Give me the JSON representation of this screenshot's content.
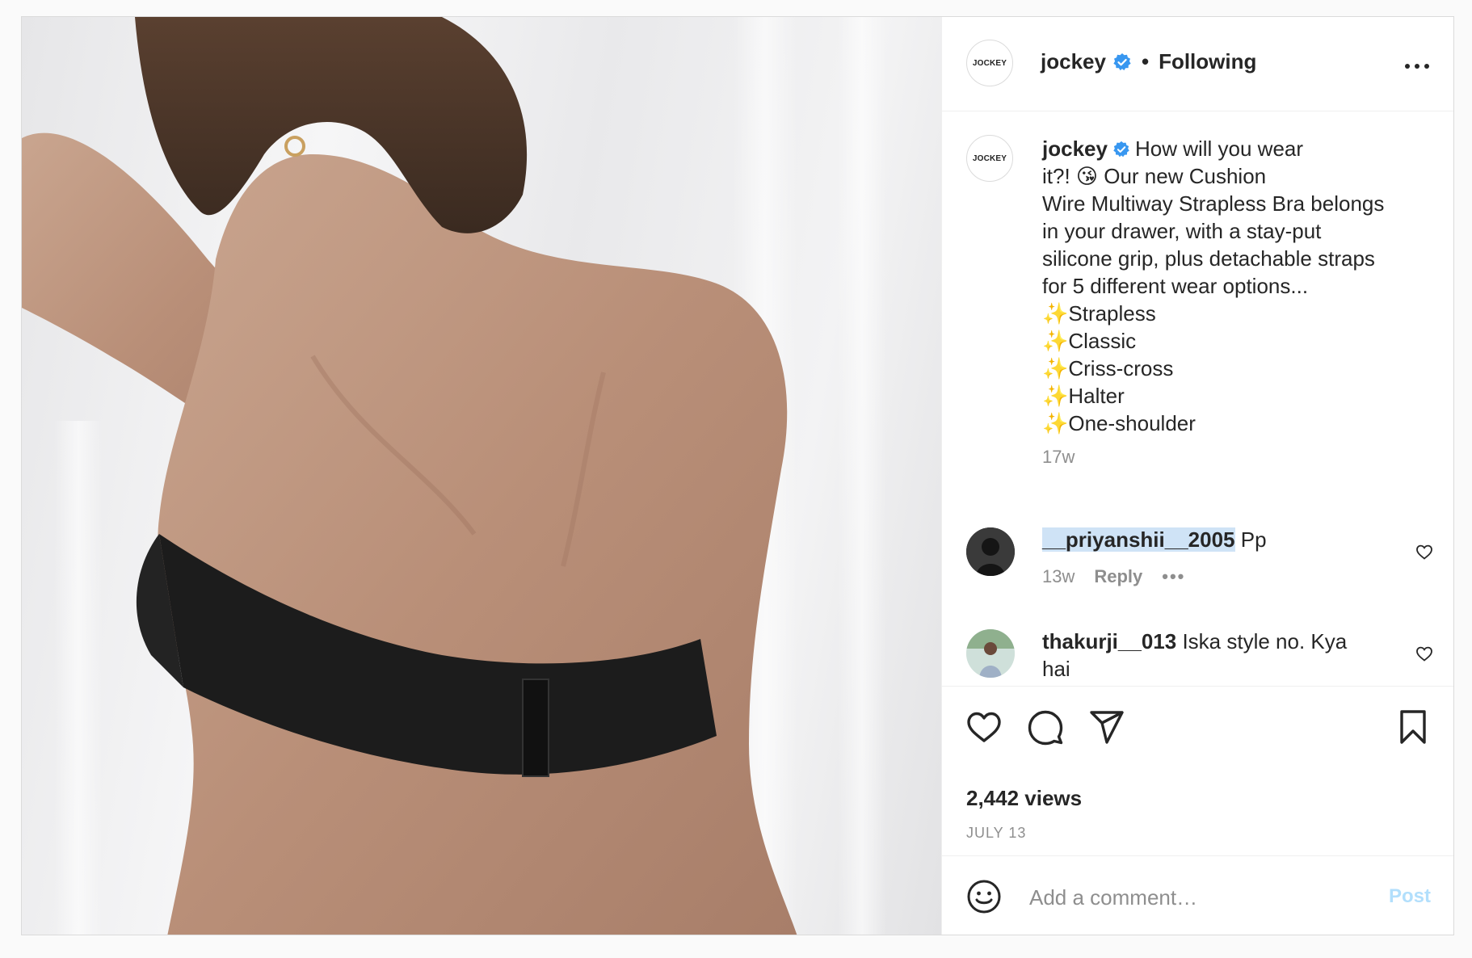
{
  "post": {
    "image_alt": "Woman wearing black strapless bra seen from the back",
    "account": {
      "avatar_text": "JOCKEY",
      "username": "jockey",
      "separator": "•",
      "follow_state": "Following"
    },
    "caption": {
      "username": "jockey",
      "lines": [
        "How will you wear",
        "it?! 😘 Our new Cushion",
        "Wire Multiway Strapless Bra belongs",
        "in your drawer, with a stay-put",
        "silicone grip, plus detachable straps",
        "for 5 different wear options...",
        "✨Strapless",
        "✨Classic",
        "✨Criss-cross",
        "✨Halter",
        "✨One-shoulder"
      ],
      "time": "17w"
    },
    "comments": [
      {
        "username": "__priyanshii__2005",
        "text": "Pp",
        "time": "13w",
        "reply_label": "Reply",
        "more_label": "•••"
      },
      {
        "username": "thakurji__013",
        "text_line1": "Iska style no. Kya",
        "text_line2": "hai"
      }
    ],
    "views": "2,442 views",
    "date": "JULY 13",
    "add_comment": {
      "placeholder": "Add a comment…",
      "post_label": "Post"
    }
  },
  "colors": {
    "verified": "#3897f0",
    "muted": "#8e8e8e",
    "post_disabled": "#b2dffc"
  }
}
